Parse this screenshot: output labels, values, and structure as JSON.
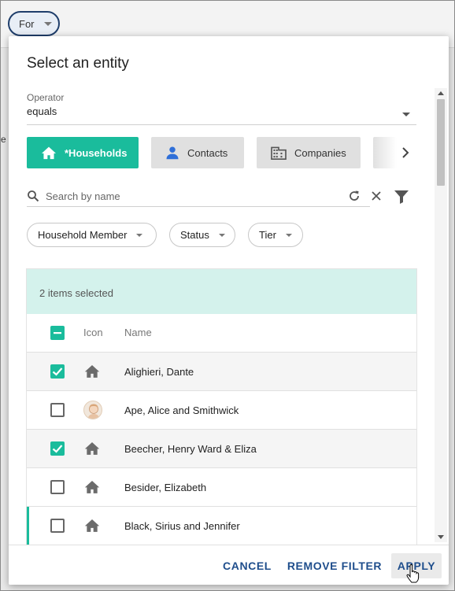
{
  "background": {
    "for_chip_label": "For",
    "partial_text": "e"
  },
  "modal": {
    "title": "Select an entity",
    "operator": {
      "label": "Operator",
      "value": "equals"
    },
    "tabs": [
      {
        "label": "*Households",
        "icon": "house-icon",
        "active": true
      },
      {
        "label": "Contacts",
        "icon": "person-icon",
        "active": false
      },
      {
        "label": "Companies",
        "icon": "building-icon",
        "active": false
      }
    ],
    "search": {
      "placeholder": "Search by name"
    },
    "filters": [
      {
        "label": "Household Member"
      },
      {
        "label": "Status"
      },
      {
        "label": "Tier"
      }
    ],
    "list": {
      "selection_text": "2 items selected",
      "columns": {
        "icon": "Icon",
        "name": "Name"
      },
      "rows": [
        {
          "name": "Alighieri, Dante",
          "icon": "house-icon",
          "checked": true
        },
        {
          "name": "Ape, Alice and Smithwick",
          "icon": "avatar",
          "checked": false
        },
        {
          "name": "Beecher, Henry Ward & Eliza",
          "icon": "house-icon",
          "checked": true
        },
        {
          "name": "Besider, Elizabeth",
          "icon": "house-icon",
          "checked": false
        },
        {
          "name": "Black, Sirius and Jennifer",
          "icon": "house-icon",
          "checked": false
        }
      ]
    },
    "footer": {
      "cancel": "CANCEL",
      "remove_filter": "REMOVE FILTER",
      "apply": "APPLY"
    }
  },
  "colors": {
    "accent": "#1abc9c",
    "selection_bar": "#d4f2ec",
    "button_text": "#1f4e8c"
  }
}
